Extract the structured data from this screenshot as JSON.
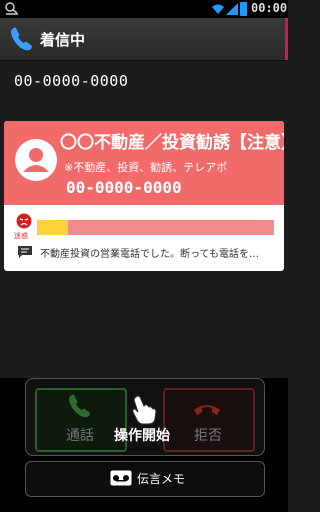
{
  "status_bar": {
    "time": "00:00"
  },
  "titlebar": {
    "title": "着信中"
  },
  "caller": {
    "number": "00-0000-0000"
  },
  "card": {
    "title": "〇〇不動産／投資勧誘【注意】",
    "subtitle": "※不動産、投資、勧誘、テレアポ",
    "number": "00-0000-0000",
    "face_label": "迷惑",
    "rating_fraction": 0.13,
    "comment": "不動産投資の営業電話でした。断っても電話を…",
    "colors": {
      "header": "#f26b6b",
      "bar_bad": "#f28c8c",
      "bar_fill": "#ffd23c"
    }
  },
  "actions": {
    "answer_label": "通話",
    "operate_label": "操作開始",
    "reject_label": "拒否",
    "memo_label": "伝言メモ"
  },
  "icons": {
    "status_left": "call-status-icon",
    "title": "phone-icon",
    "avatar": "person-avatar-icon",
    "face": "angry-face-icon",
    "comment": "comment-icon",
    "answer": "phone-answer-icon",
    "reject": "phone-hangup-icon",
    "hand": "pointing-hand-icon",
    "memo": "voicemail-icon"
  }
}
